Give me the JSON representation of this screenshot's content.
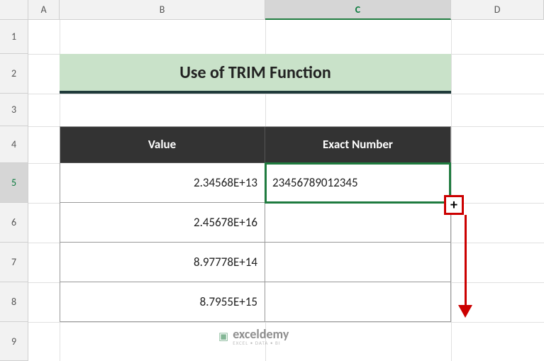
{
  "columns": [
    "A",
    "B",
    "C",
    "D"
  ],
  "rows": [
    "1",
    "2",
    "3",
    "4",
    "5",
    "6",
    "7",
    "8",
    "9"
  ],
  "selectedRow": "5",
  "selectedCol": "C",
  "title": "Use of TRIM Function",
  "headers": {
    "value": "Value",
    "exact": "Exact Number"
  },
  "table": {
    "rows": [
      {
        "value": "2.34568E+13",
        "exact": "23456789012345"
      },
      {
        "value": "2.45678E+16",
        "exact": ""
      },
      {
        "value": "8.97778E+14",
        "exact": ""
      },
      {
        "value": "8.7955E+15",
        "exact": ""
      }
    ]
  },
  "chart_data": {
    "type": "table",
    "title": "Use of TRIM Function",
    "columns": [
      "Value",
      "Exact Number"
    ],
    "rows": [
      [
        "2.34568E+13",
        "23456789012345"
      ],
      [
        "2.45678E+16",
        ""
      ],
      [
        "8.97778E+14",
        ""
      ],
      [
        "8.7955E+15",
        ""
      ]
    ]
  },
  "watermark": {
    "brand": "exceldemy",
    "tagline": "EXCEL • DATA • BI"
  },
  "icons": {
    "fill": "+",
    "logo": "▣"
  }
}
